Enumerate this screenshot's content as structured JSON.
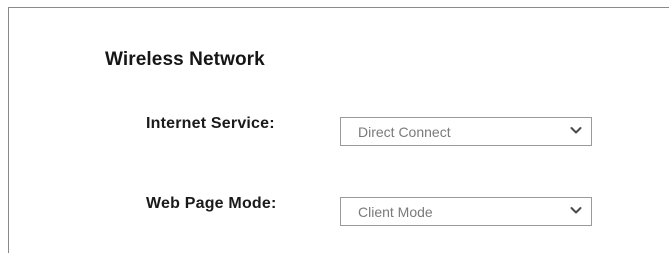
{
  "section": {
    "title": "Wireless Network"
  },
  "internet_service": {
    "label": "Internet Service:",
    "value": "Direct Connect",
    "icon": "chevron-down-icon"
  },
  "web_page_mode": {
    "label": "Web Page Mode:",
    "value": "Client Mode",
    "icon": "chevron-down-icon"
  },
  "colors": {
    "border": "#9a9a9a",
    "panel_border": "#8a8a8a",
    "value_text": "#7a7a7a",
    "label_text": "#1a1a1a"
  }
}
